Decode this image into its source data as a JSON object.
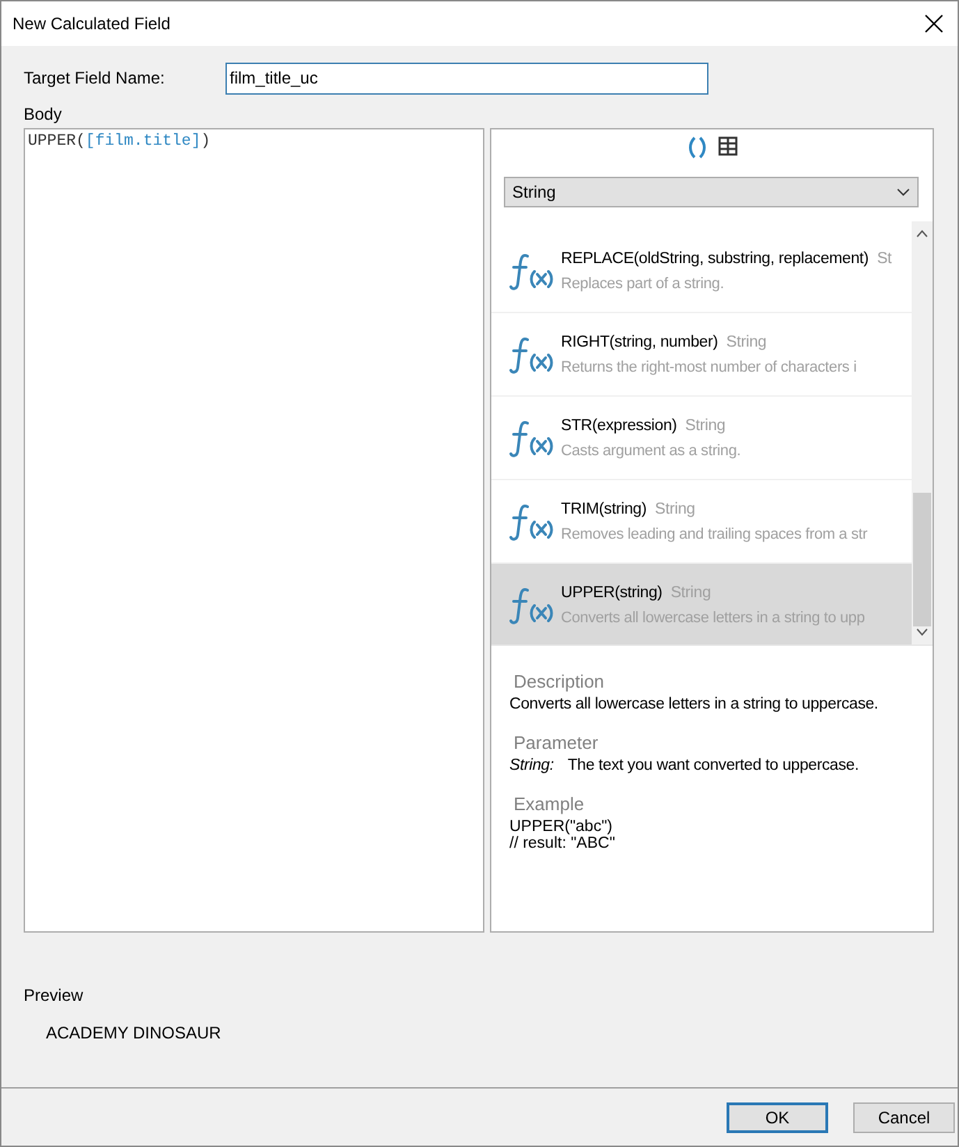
{
  "window": {
    "title": "New Calculated Field"
  },
  "target_field": {
    "label": "Target Field Name:",
    "value": "film_title_uc"
  },
  "body": {
    "label": "Body",
    "expression": "UPPER(",
    "field_ref": "[film.title]",
    "expression_end": ")"
  },
  "function_panel": {
    "category": "String",
    "functions": [
      {
        "signature": "REPLACE(oldString, substring, replacement)",
        "type": "St",
        "summary": "Replaces part of a string.",
        "selected": false
      },
      {
        "signature": "RIGHT(string, number)",
        "type": "String",
        "summary": "Returns the right-most number of characters i",
        "selected": false
      },
      {
        "signature": "STR(expression)",
        "type": "String",
        "summary": "Casts argument as a string.",
        "selected": false
      },
      {
        "signature": "TRIM(string)",
        "type": "String",
        "summary": "Removes leading and trailing spaces from a str",
        "selected": false
      },
      {
        "signature": "UPPER(string)",
        "type": "String",
        "summary": "Converts all lowercase letters in a string to upp",
        "selected": true
      }
    ],
    "description": {
      "heading": "Description",
      "text": "Converts all lowercase letters in a string to uppercase."
    },
    "parameter": {
      "heading": "Parameter",
      "name": "String:",
      "text": "The text you want converted to uppercase."
    },
    "example": {
      "heading": "Example",
      "lines": [
        "UPPER(\"abc\")",
        "// result: \"ABC\""
      ]
    }
  },
  "preview": {
    "label": "Preview",
    "value": "ACADEMY DINOSAUR"
  },
  "buttons": [
    {
      "label": "OK",
      "default": true
    },
    {
      "label": "Cancel",
      "default": false
    }
  ]
}
